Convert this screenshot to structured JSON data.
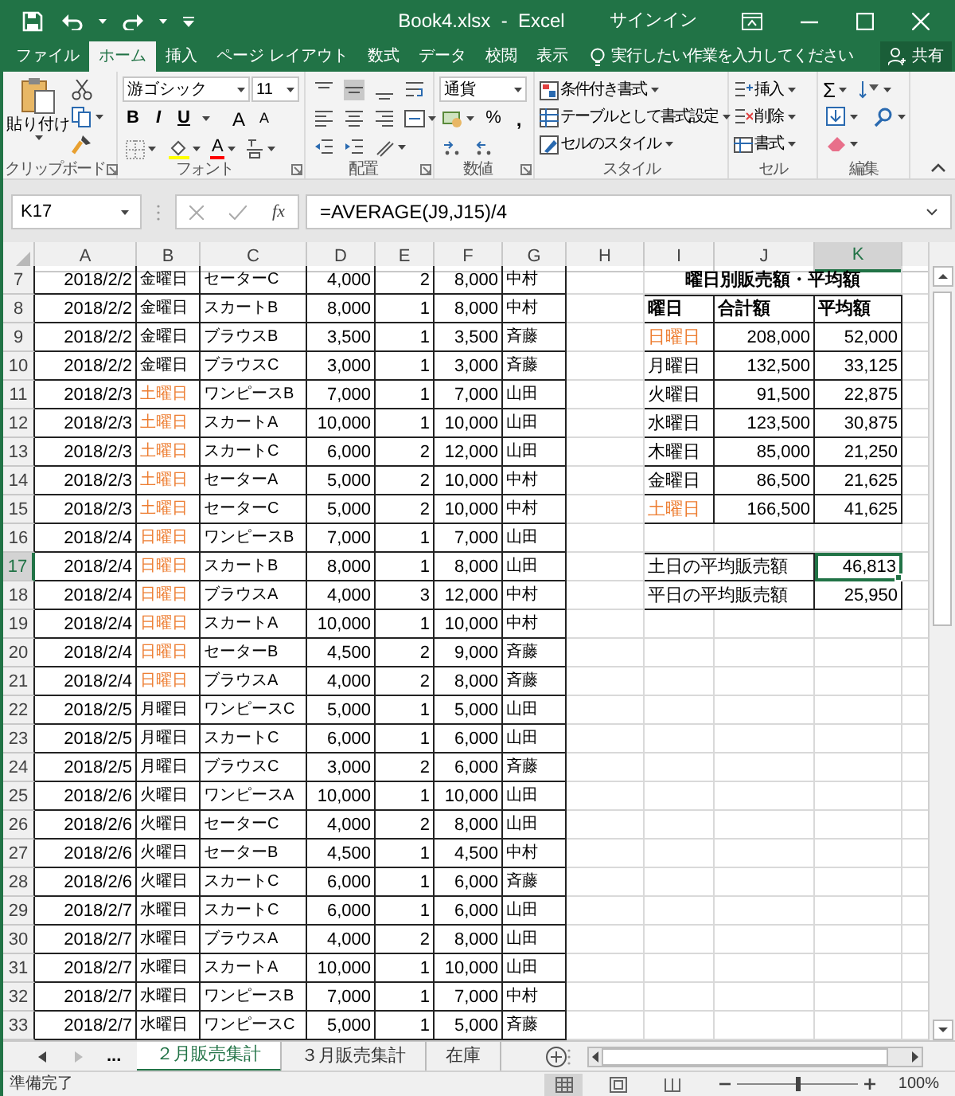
{
  "window": {
    "title": "Book4.xlsx  -  Excel",
    "sign_in": "サインイン"
  },
  "tabs": [
    {
      "label": "ファイル",
      "selected": false
    },
    {
      "label": "ホーム",
      "selected": true
    },
    {
      "label": "挿入",
      "selected": false
    },
    {
      "label": "ページ レイアウト",
      "selected": false
    },
    {
      "label": "数式",
      "selected": false
    },
    {
      "label": "データ",
      "selected": false
    },
    {
      "label": "校閲",
      "selected": false
    },
    {
      "label": "表示",
      "selected": false
    }
  ],
  "tell_me": {
    "placeholder": "実行したい作業を入力してください"
  },
  "share": "共有",
  "ribbon": [
    {
      "kind": "clipboard",
      "label": "クリップボード",
      "launcher": true,
      "paste": "貼り付け"
    },
    {
      "kind": "font",
      "label": "フォント",
      "launcher": true,
      "font_name": "游ゴシック",
      "font_size": "11",
      "styles": [
        "B",
        "I",
        "U"
      ],
      "grow": "A",
      "shrink": "A",
      "color_letter": "A"
    },
    {
      "kind": "alignment",
      "label": "配置",
      "launcher": true
    },
    {
      "kind": "number",
      "label": "数値",
      "launcher": true,
      "format": "通貨",
      "percent": "%",
      "comma": ","
    },
    {
      "kind": "styles",
      "label": "スタイル",
      "launcher": false,
      "items": [
        "条件付き書式",
        "テーブルとして書式設定",
        "セルのスタイル"
      ]
    },
    {
      "kind": "cells",
      "label": "セル",
      "launcher": false,
      "items": [
        "挿入",
        "削除",
        "書式"
      ]
    },
    {
      "kind": "editing",
      "label": "編集",
      "launcher": false,
      "sum": "Σ"
    }
  ],
  "formula_bar": {
    "name_box": "K17",
    "fx": "fx",
    "formula": "=AVERAGE(J9,J15)/4"
  },
  "columns": [
    {
      "label": "A",
      "selected": false
    },
    {
      "label": "B",
      "selected": false
    },
    {
      "label": "C",
      "selected": false
    },
    {
      "label": "D",
      "selected": false
    },
    {
      "label": "E",
      "selected": false
    },
    {
      "label": "F",
      "selected": false
    },
    {
      "label": "G",
      "selected": false
    },
    {
      "label": "H",
      "selected": false
    },
    {
      "label": "I",
      "selected": false
    },
    {
      "label": "J",
      "selected": false
    },
    {
      "label": "K",
      "selected": true
    }
  ],
  "rows": [
    {
      "n": "7",
      "selected": false,
      "date": "2018/2/2",
      "day": {
        "text": "金曜日",
        "color": "#000000"
      },
      "item": "セーターC",
      "price": "4,000",
      "qty": "2",
      "amount": "8,000",
      "staff": "中村"
    },
    {
      "n": "8",
      "selected": false,
      "date": "2018/2/2",
      "day": {
        "text": "金曜日",
        "color": "#000000"
      },
      "item": "スカートB",
      "price": "8,000",
      "qty": "1",
      "amount": "8,000",
      "staff": "中村"
    },
    {
      "n": "9",
      "selected": false,
      "date": "2018/2/2",
      "day": {
        "text": "金曜日",
        "color": "#000000"
      },
      "item": "ブラウスB",
      "price": "3,500",
      "qty": "1",
      "amount": "3,500",
      "staff": "斉藤"
    },
    {
      "n": "10",
      "selected": false,
      "date": "2018/2/2",
      "day": {
        "text": "金曜日",
        "color": "#000000"
      },
      "item": "ブラウスC",
      "price": "3,000",
      "qty": "1",
      "amount": "3,000",
      "staff": "斉藤"
    },
    {
      "n": "11",
      "selected": false,
      "date": "2018/2/3",
      "day": {
        "text": "土曜日",
        "color": "#ed7d31"
      },
      "item": "ワンピースB",
      "price": "7,000",
      "qty": "1",
      "amount": "7,000",
      "staff": "山田"
    },
    {
      "n": "12",
      "selected": false,
      "date": "2018/2/3",
      "day": {
        "text": "土曜日",
        "color": "#ed7d31"
      },
      "item": "スカートA",
      "price": "10,000",
      "qty": "1",
      "amount": "10,000",
      "staff": "山田"
    },
    {
      "n": "13",
      "selected": false,
      "date": "2018/2/3",
      "day": {
        "text": "土曜日",
        "color": "#ed7d31"
      },
      "item": "スカートC",
      "price": "6,000",
      "qty": "2",
      "amount": "12,000",
      "staff": "山田"
    },
    {
      "n": "14",
      "selected": false,
      "date": "2018/2/3",
      "day": {
        "text": "土曜日",
        "color": "#ed7d31"
      },
      "item": "セーターA",
      "price": "5,000",
      "qty": "2",
      "amount": "10,000",
      "staff": "中村"
    },
    {
      "n": "15",
      "selected": false,
      "date": "2018/2/3",
      "day": {
        "text": "土曜日",
        "color": "#ed7d31"
      },
      "item": "セーターC",
      "price": "5,000",
      "qty": "2",
      "amount": "10,000",
      "staff": "中村"
    },
    {
      "n": "16",
      "selected": false,
      "date": "2018/2/4",
      "day": {
        "text": "日曜日",
        "color": "#ed7d31"
      },
      "item": "ワンピースB",
      "price": "7,000",
      "qty": "1",
      "amount": "7,000",
      "staff": "山田"
    },
    {
      "n": "17",
      "selected": true,
      "date": "2018/2/4",
      "day": {
        "text": "日曜日",
        "color": "#ed7d31"
      },
      "item": "スカートB",
      "price": "8,000",
      "qty": "1",
      "amount": "8,000",
      "staff": "山田"
    },
    {
      "n": "18",
      "selected": false,
      "date": "2018/2/4",
      "day": {
        "text": "日曜日",
        "color": "#ed7d31"
      },
      "item": "ブラウスA",
      "price": "4,000",
      "qty": "3",
      "amount": "12,000",
      "staff": "中村"
    },
    {
      "n": "19",
      "selected": false,
      "date": "2018/2/4",
      "day": {
        "text": "日曜日",
        "color": "#ed7d31"
      },
      "item": "スカートA",
      "price": "10,000",
      "qty": "1",
      "amount": "10,000",
      "staff": "中村"
    },
    {
      "n": "20",
      "selected": false,
      "date": "2018/2/4",
      "day": {
        "text": "日曜日",
        "color": "#ed7d31"
      },
      "item": "セーターB",
      "price": "4,500",
      "qty": "2",
      "amount": "9,000",
      "staff": "斉藤"
    },
    {
      "n": "21",
      "selected": false,
      "date": "2018/2/4",
      "day": {
        "text": "日曜日",
        "color": "#ed7d31"
      },
      "item": "ブラウスA",
      "price": "4,000",
      "qty": "2",
      "amount": "8,000",
      "staff": "斉藤"
    },
    {
      "n": "22",
      "selected": false,
      "date": "2018/2/5",
      "day": {
        "text": "月曜日",
        "color": "#000000"
      },
      "item": "ワンピースC",
      "price": "5,000",
      "qty": "1",
      "amount": "5,000",
      "staff": "山田"
    },
    {
      "n": "23",
      "selected": false,
      "date": "2018/2/5",
      "day": {
        "text": "月曜日",
        "color": "#000000"
      },
      "item": "スカートC",
      "price": "6,000",
      "qty": "1",
      "amount": "6,000",
      "staff": "山田"
    },
    {
      "n": "24",
      "selected": false,
      "date": "2018/2/5",
      "day": {
        "text": "月曜日",
        "color": "#000000"
      },
      "item": "ブラウスC",
      "price": "3,000",
      "qty": "2",
      "amount": "6,000",
      "staff": "斉藤"
    },
    {
      "n": "25",
      "selected": false,
      "date": "2018/2/6",
      "day": {
        "text": "火曜日",
        "color": "#000000"
      },
      "item": "ワンピースA",
      "price": "10,000",
      "qty": "1",
      "amount": "10,000",
      "staff": "山田"
    },
    {
      "n": "26",
      "selected": false,
      "date": "2018/2/6",
      "day": {
        "text": "火曜日",
        "color": "#000000"
      },
      "item": "セーターC",
      "price": "4,000",
      "qty": "2",
      "amount": "8,000",
      "staff": "山田"
    },
    {
      "n": "27",
      "selected": false,
      "date": "2018/2/6",
      "day": {
        "text": "火曜日",
        "color": "#000000"
      },
      "item": "セーターB",
      "price": "4,500",
      "qty": "1",
      "amount": "4,500",
      "staff": "中村"
    },
    {
      "n": "28",
      "selected": false,
      "date": "2018/2/6",
      "day": {
        "text": "火曜日",
        "color": "#000000"
      },
      "item": "スカートC",
      "price": "6,000",
      "qty": "1",
      "amount": "6,000",
      "staff": "斉藤"
    },
    {
      "n": "29",
      "selected": false,
      "date": "2018/2/7",
      "day": {
        "text": "水曜日",
        "color": "#000000"
      },
      "item": "スカートC",
      "price": "6,000",
      "qty": "1",
      "amount": "6,000",
      "staff": "山田"
    },
    {
      "n": "30",
      "selected": false,
      "date": "2018/2/7",
      "day": {
        "text": "水曜日",
        "color": "#000000"
      },
      "item": "ブラウスA",
      "price": "4,000",
      "qty": "2",
      "amount": "8,000",
      "staff": "山田"
    },
    {
      "n": "31",
      "selected": false,
      "date": "2018/2/7",
      "day": {
        "text": "水曜日",
        "color": "#000000"
      },
      "item": "スカートA",
      "price": "10,000",
      "qty": "1",
      "amount": "10,000",
      "staff": "山田"
    },
    {
      "n": "32",
      "selected": false,
      "date": "2018/2/7",
      "day": {
        "text": "水曜日",
        "color": "#000000"
      },
      "item": "ワンピースB",
      "price": "7,000",
      "qty": "1",
      "amount": "7,000",
      "staff": "中村"
    },
    {
      "n": "33",
      "selected": false,
      "date": "2018/2/7",
      "day": {
        "text": "水曜日",
        "color": "#000000"
      },
      "item": "ワンピースC",
      "price": "5,000",
      "qty": "1",
      "amount": "5,000",
      "staff": "斉藤"
    }
  ],
  "summary": {
    "title": "曜日別販売額・平均額",
    "headers": [
      "曜日",
      "合計額",
      "平均額"
    ],
    "days": [
      {
        "day": "日曜日",
        "color": "#ed7d31",
        "total": "208,000",
        "avg": "52,000"
      },
      {
        "day": "月曜日",
        "color": "#000000",
        "total": "132,500",
        "avg": "33,125"
      },
      {
        "day": "火曜日",
        "color": "#000000",
        "total": "91,500",
        "avg": "22,875"
      },
      {
        "day": "水曜日",
        "color": "#000000",
        "total": "123,500",
        "avg": "30,875"
      },
      {
        "day": "木曜日",
        "color": "#000000",
        "total": "85,000",
        "avg": "21,250"
      },
      {
        "day": "金曜日",
        "color": "#000000",
        "total": "86,500",
        "avg": "21,625"
      },
      {
        "day": "土曜日",
        "color": "#ed7d31",
        "total": "166,500",
        "avg": "41,625"
      }
    ],
    "averages": [
      {
        "label": "土日の平均販売額",
        "value": "46,813",
        "selected": true
      },
      {
        "label": "平日の平均販売額",
        "value": "25,950",
        "selected": false
      }
    ]
  },
  "sheet_tabs": {
    "more": "...",
    "tabs": [
      {
        "label": "２月販売集計",
        "selected": true
      },
      {
        "label": "３月販売集計",
        "selected": false
      },
      {
        "label": "在庫",
        "selected": false
      }
    ]
  },
  "status_bar": {
    "text": "準備完了",
    "views": [
      {
        "kind": "normal",
        "selected": true
      },
      {
        "kind": "layout",
        "selected": false
      },
      {
        "kind": "pagebreak",
        "selected": false
      }
    ],
    "zoom": {
      "level": 0.5,
      "reading": "100%"
    }
  }
}
